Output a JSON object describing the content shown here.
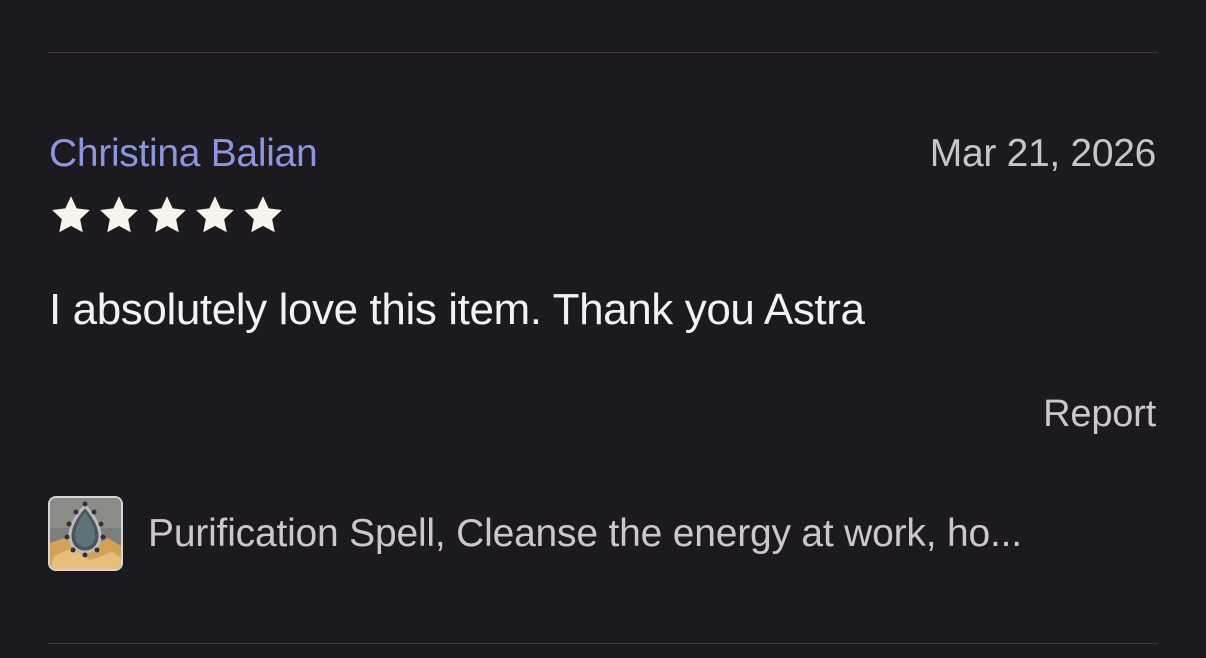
{
  "review": {
    "author": "Christina Balian",
    "date": "Mar 21, 2026",
    "rating": 5,
    "rating_max": 5,
    "text": "I absolutely love this item. Thank you Astra",
    "report_label": "Report"
  },
  "product": {
    "title": "Purification Spell, Cleanse the energy at work, ho..."
  },
  "colors": {
    "background": "#1c1a1f",
    "author_link": "#8b95e0",
    "star": "#f7f4ee",
    "divider": "#3d3842"
  },
  "icons": {
    "star": "star-icon",
    "product_thumbnail": "product-thumbnail-image"
  }
}
